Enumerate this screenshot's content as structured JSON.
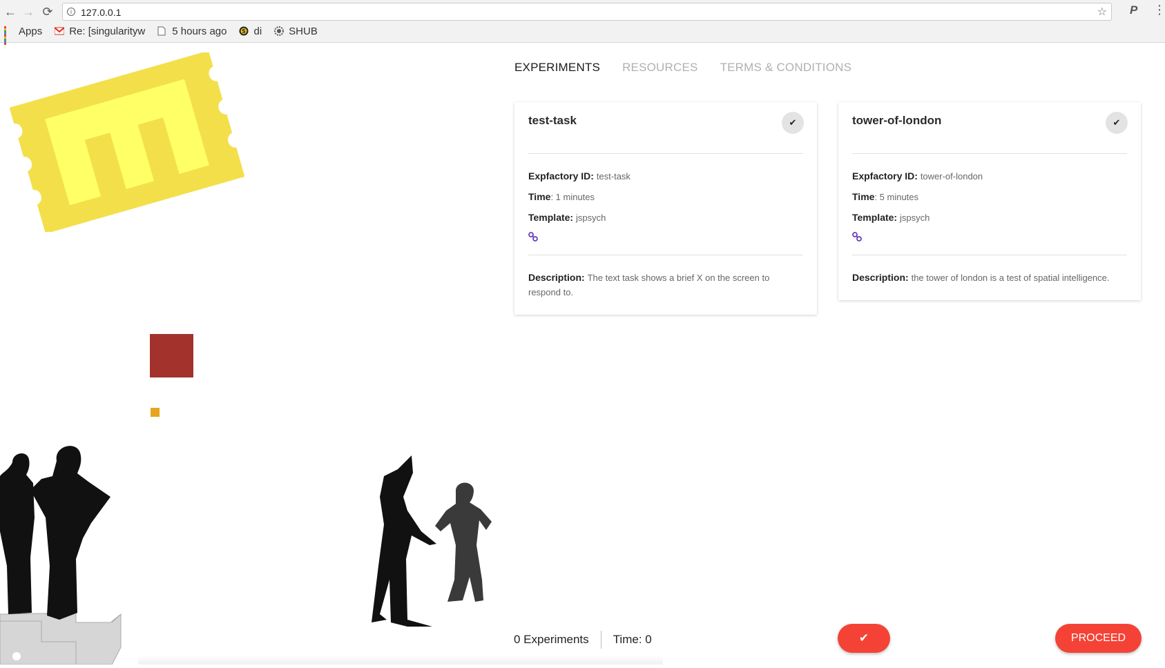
{
  "browser": {
    "url": "127.0.0.1",
    "bookmarks": [
      {
        "label": "Apps",
        "icon": "apps-grid-icon"
      },
      {
        "label": "Re: [singularityw",
        "icon": "gmail-icon"
      },
      {
        "label": "5 hours ago",
        "icon": "page-icon"
      },
      {
        "label": "di",
        "icon": "s-circle-icon"
      },
      {
        "label": "SHUB",
        "icon": "gear-chip-icon"
      }
    ]
  },
  "nav": {
    "tabs": [
      {
        "label": "EXPERIMENTS",
        "active": true
      },
      {
        "label": "RESOURCES",
        "active": false
      },
      {
        "label": "TERMS & CONDITIONS",
        "active": false
      }
    ]
  },
  "cards": [
    {
      "title": "test-task",
      "id_label": "Expfactory ID:",
      "id_value": "test-task",
      "time_label": "Time",
      "time_value": ": 1 minutes",
      "template_label": "Template:",
      "template_value": "jspsych",
      "description_label": "Description:",
      "description_value": "The text task shows a brief X on the screen to respond to."
    },
    {
      "title": "tower-of-london",
      "id_label": "Expfactory ID:",
      "id_value": "tower-of-london",
      "time_label": "Time",
      "time_value": ": 5 minutes",
      "template_label": "Template:",
      "template_value": "jspsych",
      "description_label": "Description:",
      "description_value": "the tower of london is a test of spatial intelligence."
    }
  ],
  "footer": {
    "experiments_count": "0 Experiments",
    "time": "Time: 0",
    "check_icon": "✔",
    "proceed_label": "PROCEED"
  },
  "colors": {
    "accent": "#f44336",
    "ticket": "#f3df4a",
    "ticket_inner": "#ffff66",
    "red_square": "#a2322b",
    "orange_square": "#e5a51f",
    "link": "#6a3dbb"
  }
}
